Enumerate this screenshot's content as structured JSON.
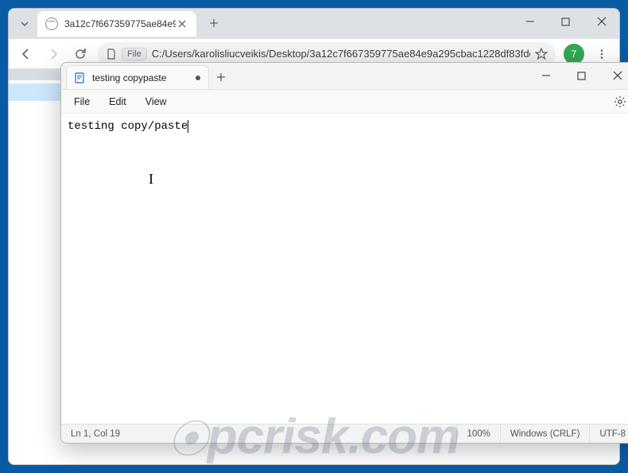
{
  "chrome": {
    "tab": {
      "title": "3a12c7f667359775ae84e9a295…"
    },
    "toolbar": {
      "file_chip": "File",
      "url": "C:/Users/karolisliucveikis/Desktop/3a12c7f667359775ae84e9a295cbac1228df83fdd1b51bbd992096e0d3…",
      "avatar_initial": "7"
    }
  },
  "notepad": {
    "tab_title": "testing copypaste",
    "menus": {
      "file": "File",
      "edit": "Edit",
      "view": "View"
    },
    "content": "testing copy/paste",
    "status": {
      "position": "Ln 1, Col 19",
      "zoom": "100%",
      "eol": "Windows (CRLF)",
      "encoding": "UTF-8"
    }
  },
  "watermark": "pcrisk.com"
}
